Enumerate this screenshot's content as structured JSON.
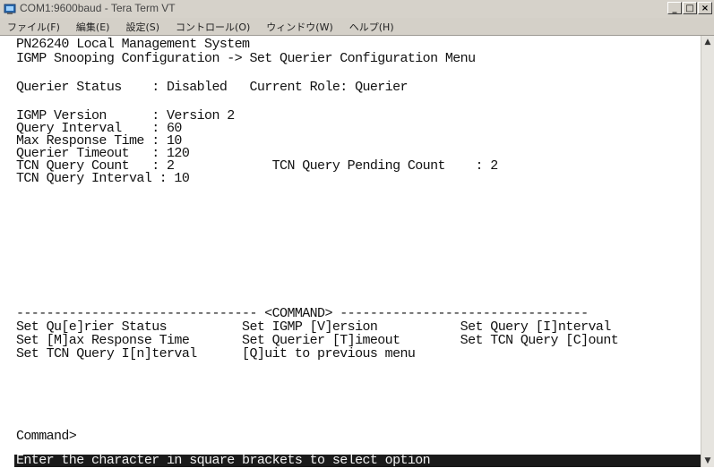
{
  "window": {
    "title": "COM1:9600baud - Tera Term VT",
    "controls": [
      "_",
      "□",
      "×"
    ]
  },
  "menu": [
    "ファイル(F)",
    "編集(E)",
    "設定(S)",
    "コントロール(O)",
    "ウィンドウ(W)",
    "ヘルプ(H)"
  ],
  "terminal": {
    "header1": "PN26240 Local Management System",
    "header2": "IGMP Snooping Configuration -> Set Querier Configuration Menu",
    "status_line": "Querier Status    : Disabled   Current Role: Querier",
    "settings": [
      "IGMP Version      : Version 2",
      "Query Interval    : 60",
      "Max Response Time : 10",
      "Querier Timeout   : 120",
      "TCN Query Count   : 2             TCN Query Pending Count    : 2",
      "TCN Query Interval : 10"
    ],
    "command_divider": "-------------------------------- <COMMAND> ---------------------------------",
    "commands": [
      "Set Qu[e]rier Status          Set IGMP [V]ersion           Set Query [I]nterval",
      "Set [M]ax Response Time       Set Querier [T]imeout        Set TCN Query [C]ount",
      "Set TCN Query I[n]terval      [Q]uit to previous menu"
    ],
    "prompt": "Command>",
    "status_bar": "Enter the character in square brackets to select option"
  }
}
